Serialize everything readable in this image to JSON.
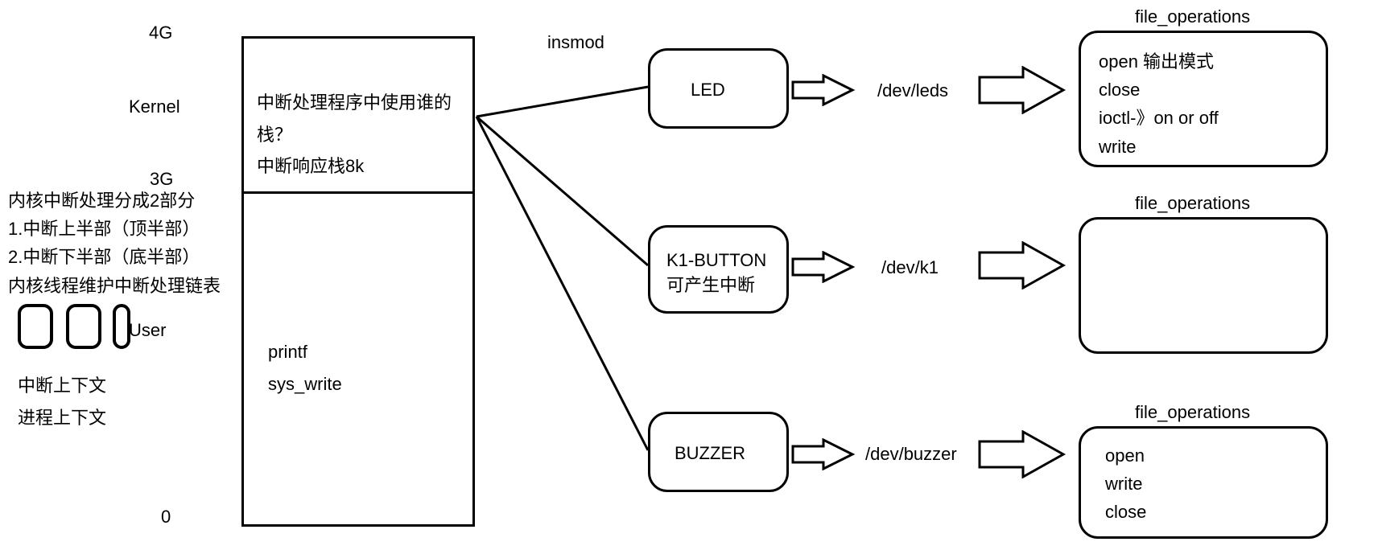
{
  "memory": {
    "label_4g": "4G",
    "label_kernel": "Kernel",
    "label_3g": "3G",
    "label_user": "User",
    "label_0": "0",
    "kernel_text_1": "中断处理程序中使用谁的栈？",
    "kernel_text_2": "中断响应栈8k",
    "user_text_1": "printf",
    "user_text_2": "sys_write"
  },
  "left_notes": {
    "line1": "内核中断处理分成2部分",
    "line2": "1.中断上半部（顶半部）",
    "line3": "2.中断下半部（底半部）",
    "line4": "内核线程维护中断处理链表",
    "line5": "中断上下文",
    "line6": "进程上下文"
  },
  "insmod": "insmod",
  "devices": {
    "led": {
      "label": "LED",
      "path": "/dev/leds"
    },
    "button": {
      "label1": "K1-BUTTON",
      "label2": "可产生中断",
      "path": "/dev/k1"
    },
    "buzzer": {
      "label": "BUZZER",
      "path": "/dev/buzzer"
    }
  },
  "fops": {
    "title": "file_operations",
    "led": {
      "l1": "open   输出模式",
      "l2": "close",
      "l3": "ioctl-》on or off",
      "l4": "write"
    },
    "buzzer": {
      "l1": "open",
      "l2": "write",
      "l3": "close"
    }
  }
}
